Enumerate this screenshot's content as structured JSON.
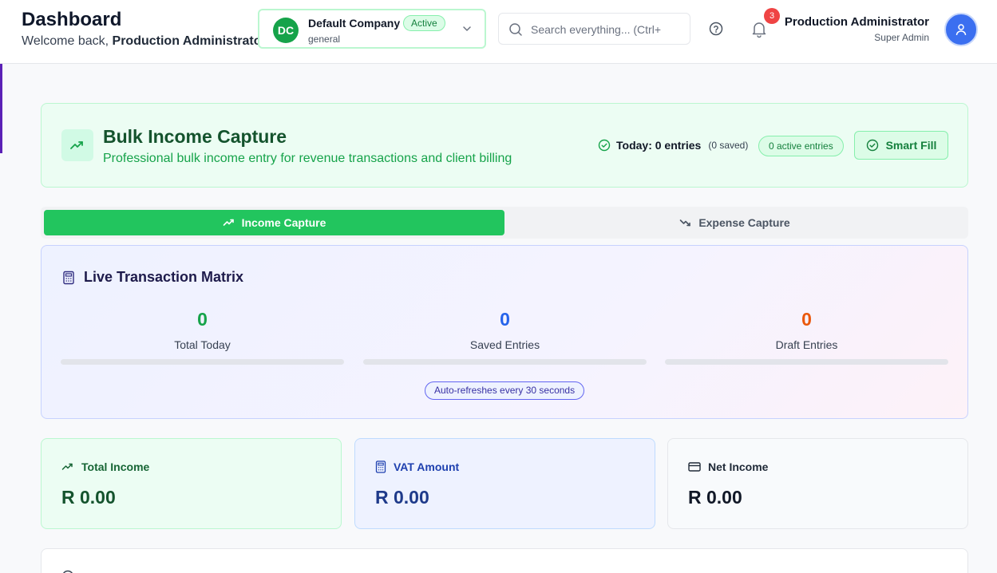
{
  "header": {
    "title": "Dashboard",
    "welcome_prefix": "Welcome back,",
    "welcome_name": "Production Administrator",
    "company": {
      "initials": "DC",
      "name": "Default Company",
      "status": "Active",
      "subtitle": "general"
    },
    "search": {
      "placeholder": "Search everything... (Ctrl+"
    },
    "notifications_count": "3",
    "user": {
      "name": "Production Administrator",
      "role": "Super Admin"
    }
  },
  "hero": {
    "title": "Bulk Income Capture",
    "subtitle": "Professional bulk income entry for revenue transactions and client billing",
    "today_label": "Today: 0 entries",
    "today_saved": "(0 saved)",
    "active_entries": "0 active entries",
    "smart_fill_label": "Smart Fill"
  },
  "tabs": [
    {
      "label": "Income Capture",
      "active": true
    },
    {
      "label": "Expense Capture",
      "active": false
    }
  ],
  "matrix": {
    "title": "Live Transaction Matrix",
    "stats": [
      {
        "value": "0",
        "label": "Total Today",
        "color": "#16a34a",
        "progress": 0
      },
      {
        "value": "0",
        "label": "Saved Entries",
        "color": "#2563eb",
        "progress": 0
      },
      {
        "value": "0",
        "label": "Draft Entries",
        "color": "#ea580c",
        "progress": 0
      }
    ],
    "auto_refresh": "Auto-refreshes every 30 seconds"
  },
  "summary": {
    "income": {
      "label": "Total Income",
      "value": "R 0.00"
    },
    "vat": {
      "label": "VAT Amount",
      "value": "R 0.00"
    },
    "net": {
      "label": "Net Income",
      "value": "R 0.00"
    }
  },
  "colors": {
    "accent_green": "#22c55e",
    "sidebar_accent": "#5b21b6",
    "notification_red": "#ef4444",
    "avatar_blue": "#3b6ff0"
  }
}
